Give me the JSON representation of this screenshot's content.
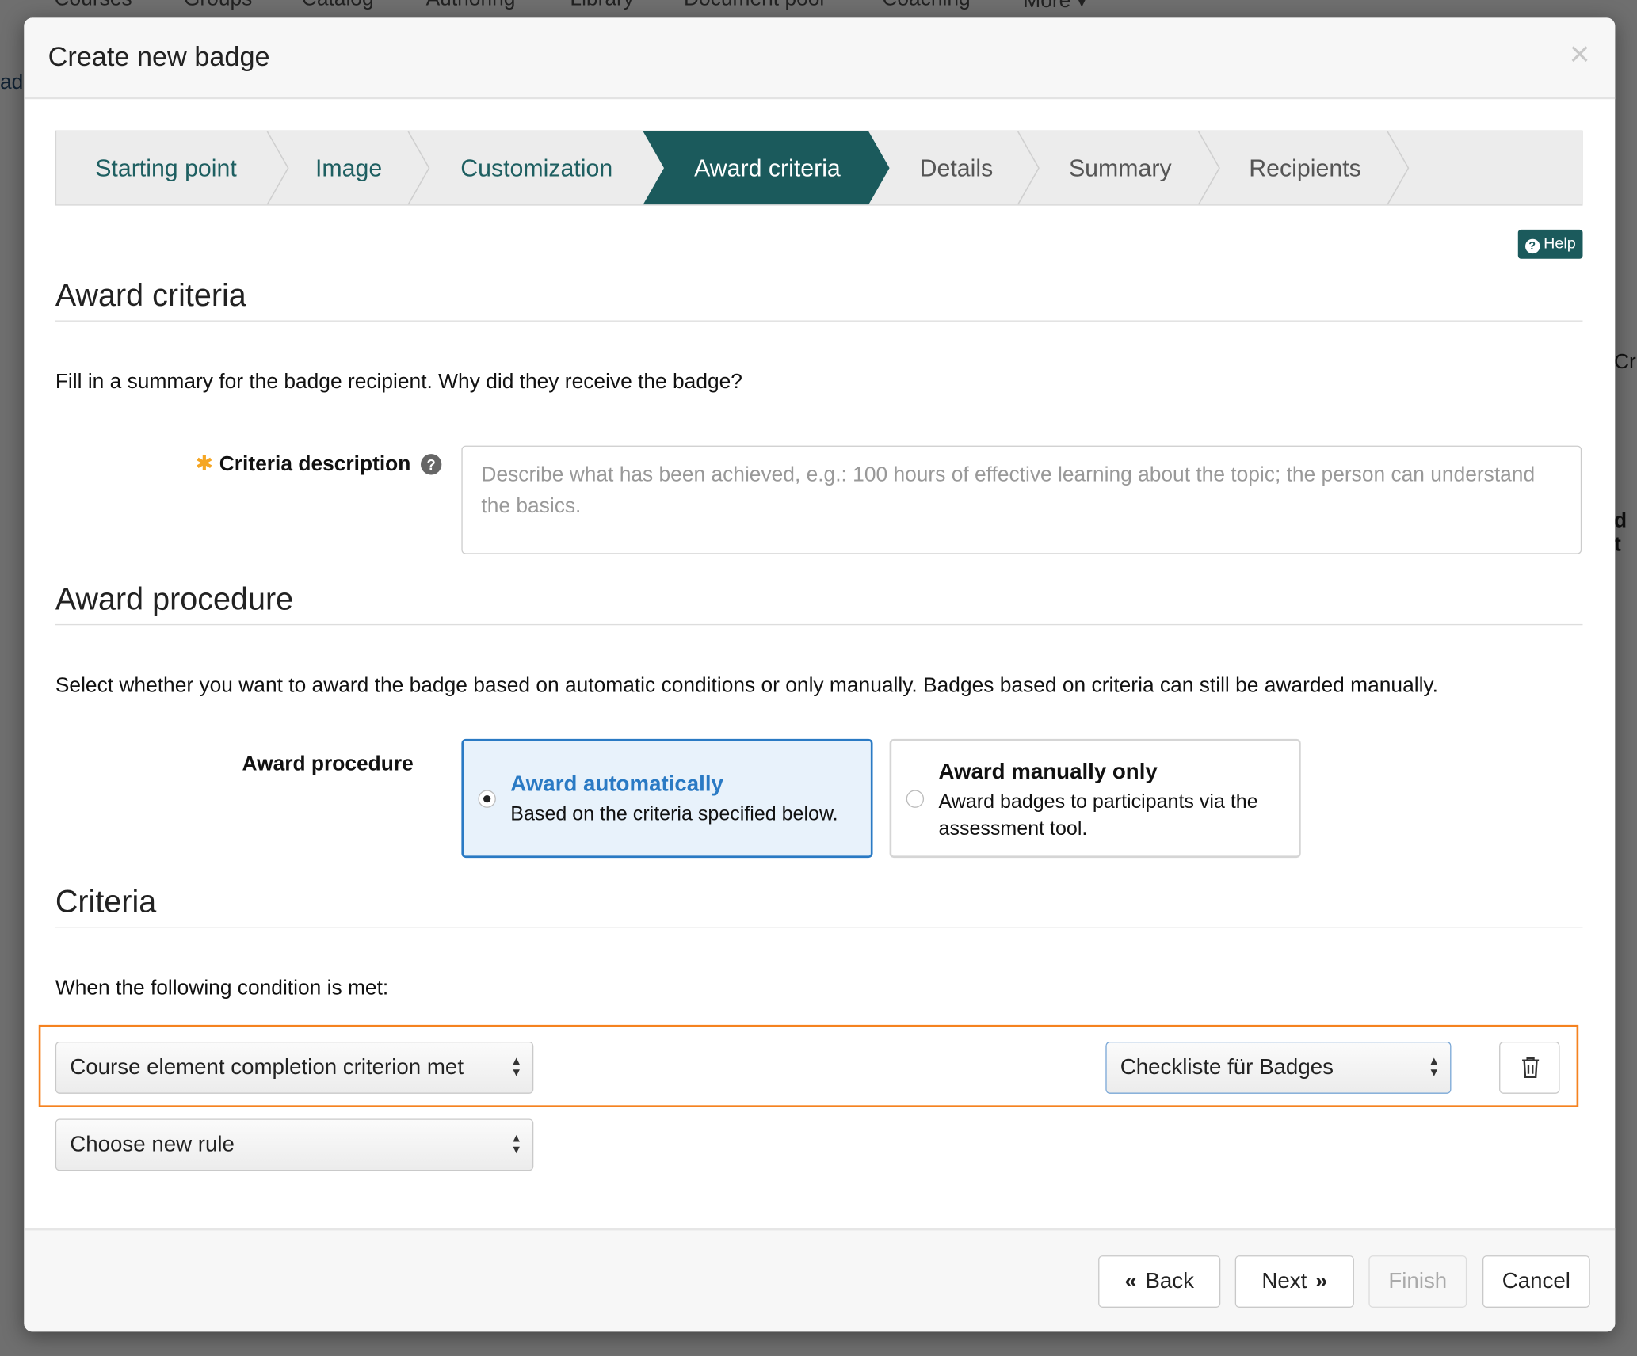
{
  "background": {
    "nav_items": [
      "Courses",
      "Groups",
      "Catalog",
      "Authoring",
      "Library",
      "Document pool",
      "Coaching",
      "More ▾"
    ],
    "side_fragments": [
      "ad",
      "Cr",
      "d t"
    ]
  },
  "dialog": {
    "title": "Create new badge",
    "close_icon": "close-icon"
  },
  "wizard": {
    "steps": [
      {
        "label": "Starting point",
        "state": "done"
      },
      {
        "label": "Image",
        "state": "done"
      },
      {
        "label": "Customization",
        "state": "done"
      },
      {
        "label": "Award criteria",
        "state": "active"
      },
      {
        "label": "Details",
        "state": "todo"
      },
      {
        "label": "Summary",
        "state": "todo"
      },
      {
        "label": "Recipients",
        "state": "todo"
      }
    ]
  },
  "help": {
    "label": "Help",
    "icon": "question-circle-icon"
  },
  "award_criteria": {
    "heading": "Award criteria",
    "intro": "Fill in a summary for the badge recipient. Why did they receive the badge?",
    "field_label": "Criteria description",
    "required_mark": "✱",
    "help_mark": "?",
    "placeholder": "Describe what has been achieved, e.g.: 100 hours of effective learning about the topic; the person can understand the basics."
  },
  "award_procedure": {
    "heading": "Award procedure",
    "intro": "Select whether you want to award the badge based on automatic conditions or only manually. Badges based on criteria can still be awarded manually.",
    "field_label": "Award procedure",
    "options": [
      {
        "title": "Award automatically",
        "description": "Based on the criteria specified below.",
        "selected": true
      },
      {
        "title": "Award manually only",
        "description": "Award badges to participants via the assessment tool.",
        "selected": false
      }
    ]
  },
  "criteria": {
    "heading": "Criteria",
    "intro": "When the following condition is met:",
    "rule_select": "Course element completion criterion met",
    "element_select": "Checkliste für Badges",
    "new_rule_select": "Choose new rule",
    "highlight_color": "#f5821f"
  },
  "footer": {
    "back": "Back",
    "next": "Next",
    "finish": "Finish",
    "cancel": "Cancel"
  },
  "colors": {
    "accent": "#1b5a5c",
    "selected_blue": "#2a7ac4"
  }
}
